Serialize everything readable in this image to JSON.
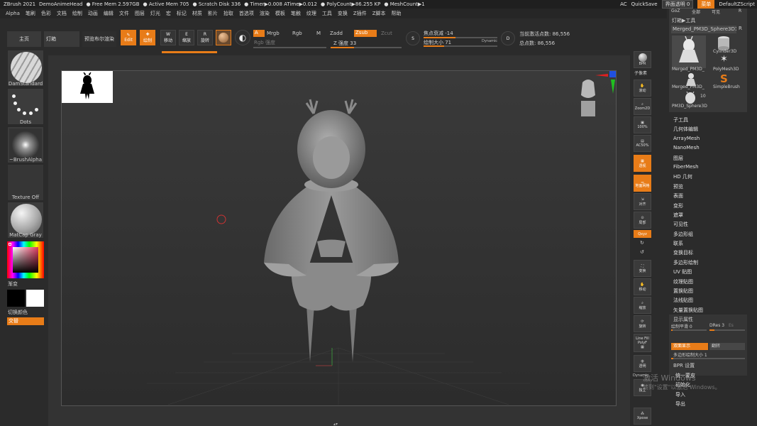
{
  "titlebar": {
    "app": "ZBrush 2021",
    "project": "DemoAnimeHead",
    "stats": [
      "● Free Mem 2.597GB",
      "● Active Mem 705",
      "● Scratch Disk 336",
      "● Timer▶0.008 ATime▶0.012",
      "● PolyCount▶86.255 KP",
      "● MeshCount▶1"
    ],
    "ac": "AC",
    "quicksave": "QuickSave",
    "transparency": "界面透明 0",
    "menu": "菜单",
    "script": "DefaultZScript"
  },
  "menubar": [
    "Alpha",
    "笔刷",
    "色彩",
    "文档",
    "绘制",
    "动画",
    "编辑",
    "文件",
    "图层",
    "灯光",
    "宏",
    "标记",
    "材质",
    "影片",
    "拾取",
    "首选项",
    "渲染",
    "模板",
    "笔触",
    "纹理",
    "工具",
    "变换",
    "Z插件",
    "Z脚本",
    "帮助"
  ],
  "toolbar": {
    "home": "主页",
    "lightbox": "灯箱",
    "bpr_preview": "预览布尔渲染",
    "edit": "Edit",
    "draw": "绘制",
    "move": "移动",
    "scale": "缩放",
    "rotate": "旋转",
    "a": "A",
    "mrgb": "Mrgb",
    "rgb": "Rgb",
    "m": "M",
    "zadd": "Zadd",
    "zsub": "Zsub",
    "zcut": "Zcut",
    "rgb_intensity": "Rgb 强度",
    "z_intensity": "Z 强度 33",
    "focal_shift": "焦点衰减 -14",
    "draw_size": "绘制大小 71",
    "dynamic": "Dynamic",
    "active_points": "当前激活点数: 86,556",
    "total_points": "总点数: 86,556"
  },
  "left_shelf": {
    "brush": "DamStandard",
    "stroke": "Dots",
    "alpha": "~BrushAlpha",
    "texture": "Texture Off",
    "material": "MatCap Gray",
    "gradient": "渐变",
    "switch_color": "切换颜色",
    "swap": "交替"
  },
  "right_tools": [
    "BPR",
    "子像素",
    "滚动",
    "Zoom2D",
    "100%",
    "AC50%",
    "透视",
    "地面网格",
    "对齐",
    "局部",
    "Qxyz",
    "",
    "",
    "变换",
    "移动",
    "缩放",
    "旋转",
    "Line Fill PolyF",
    "透明",
    "Dynamic",
    "独立",
    "Xpose"
  ],
  "tool_panel": {
    "goz": "GoZ",
    "all": "全部",
    "visible": "可见",
    "r": "R",
    "lightbox_tool": "灯箱▶工具",
    "current_tool": "Merged_PM3D_Sphere3D1",
    "r2": "R",
    "cylinder": "Cylinder3D",
    "polymesh": "PolyMesh3D",
    "merged1": "Merged_PM3D_",
    "merged2": "Merged_PM3D_",
    "simplebrush": "SimpleBrush",
    "count": "10",
    "sphere": "PM3D_Sphere3D"
  },
  "tool_list": [
    "子工具",
    "几何体编辑",
    "ArrayMesh",
    "NanoMesh",
    "图层",
    "FiberMesh",
    "HD 几何",
    "预览",
    "表面",
    "变形",
    "遮罩",
    "可见性",
    "多边形组",
    "联系",
    "变换目标",
    "多边形绘制",
    "UV 贴图",
    "纹理贴图",
    "置换贴图",
    "法线贴图",
    "矢量置换贴图"
  ],
  "display_props": {
    "title": "显示属性",
    "smooth": "绘制平滑 0",
    "dres": "DRes 3",
    "es": "Es",
    "double": "双面显示",
    "flip": "翻转",
    "poly_size": "多边形绘制大小 1",
    "bpr": "BPR 设置"
  },
  "bottom_list": [
    "统一蒙皮",
    "初始化",
    "导入",
    "导出"
  ],
  "watermark": {
    "line1": "激活 Windows",
    "line2": "转到\"设置\"以激活 Windows。"
  },
  "colors": {
    "accent": "#e87c18",
    "background": "#2b2b2b"
  }
}
